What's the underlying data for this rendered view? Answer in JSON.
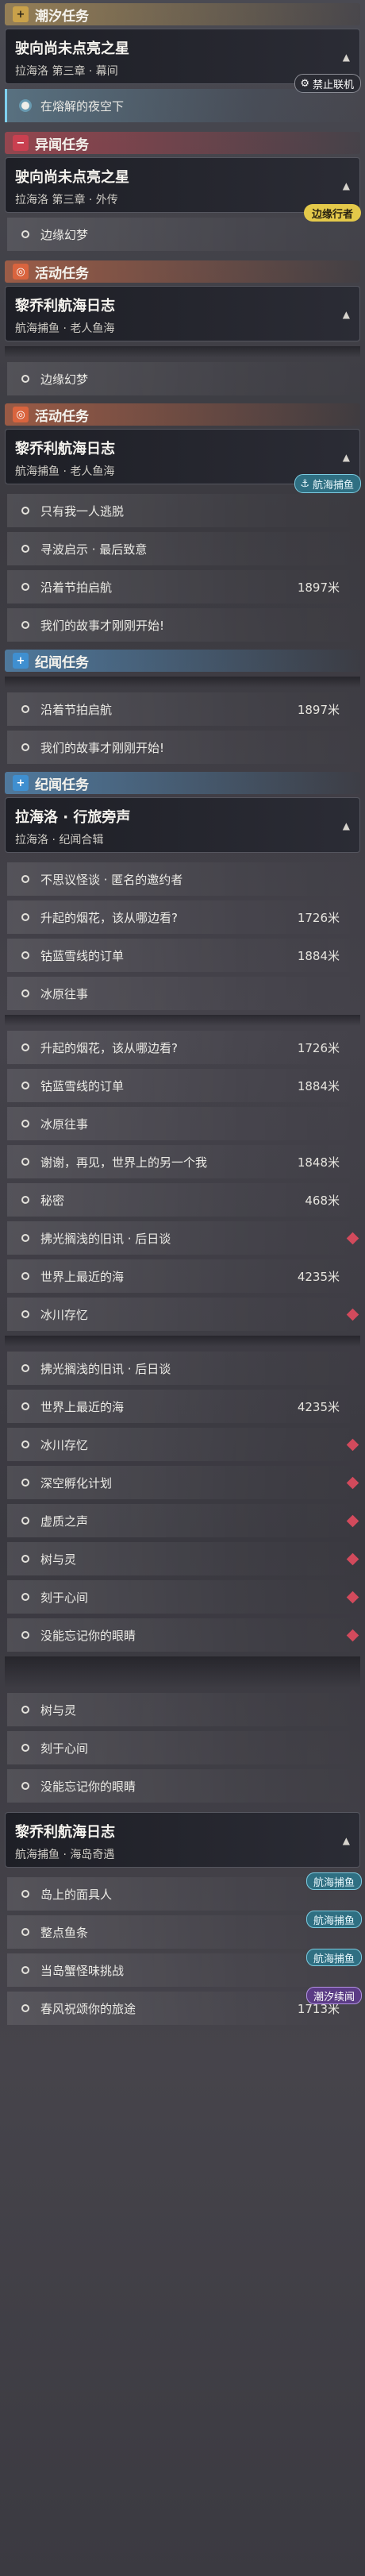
{
  "sections": {
    "chaoxi": "潮汐任务",
    "yiwen": "异闻任务",
    "huodong": "活动任务",
    "jiwen": "纪闻任务"
  },
  "quests": {
    "q1": {
      "title": "驶向尚未点亮之星",
      "sub": "拉海洛 第三章 · 幕间",
      "tag": "禁止联机"
    },
    "q2": {
      "title": "驶向尚未点亮之星",
      "sub": "拉海洛 第三章 · 外传",
      "tag": "边缘行者"
    },
    "q3": {
      "title": "黎乔利航海日志",
      "sub": "航海捕鱼 · 老人鱼海",
      "tag": "航海捕鱼"
    },
    "q4": {
      "title": "拉海洛 · 行旅旁声",
      "sub": "拉海洛 · 纪闻合辑"
    },
    "q5": {
      "title": "黎乔利航海日志",
      "sub": "航海捕鱼 · 海岛奇遇"
    }
  },
  "items": {
    "a1": "在熔解的夜空下",
    "a2": "边缘幻梦",
    "a3": "只有我一人逃脱",
    "a4": "寻波启示 · 最后致意",
    "a5": "沿着节拍启航",
    "a6": "我们的故事才刚刚开始!",
    "a7": "不思议怪谈 · 匿名的邀约者",
    "a8": "升起的烟花，该从哪边看?",
    "a9": "钴蓝雪线的订单",
    "a10": "冰原往事",
    "a11": "谢谢，再见，世界上的另一个我",
    "a12": "秘密",
    "a13": "拂光搁浅的旧讯 · 后日谈",
    "a14": "世界上最近的海",
    "a15": "冰川存忆",
    "a16": "深空孵化计划",
    "a17": "虚质之声",
    "a18": "树与灵",
    "a19": "刻于心间",
    "a20": "没能忘记你的眼睛",
    "a21": "岛上的面具人",
    "a22": "整点鱼条",
    "a23": "当岛蟹怪味挑战",
    "a24": "春风祝颂你的旅途"
  },
  "distances": {
    "d1": "1897米",
    "d2": "1726米",
    "d3": "1884米",
    "d4": "1848米",
    "d5": "468米",
    "d6": "4235米",
    "d7": "1713米"
  },
  "tags": {
    "hanghai": "航海捕鱼",
    "chaoxi_xuwen": "潮汐续闻",
    "jinzhi": "禁止联机",
    "bianyuan": "边缘行者"
  },
  "icons": {
    "chaoxi": "plus-icon",
    "yiwen": "minus-icon",
    "huodong": "swirl-icon",
    "jiwen": "plus-icon",
    "chevron": "chevron-up-icon"
  },
  "colors": {
    "accent_cyan": "#7fd0f0",
    "header_gold": "#c9a14a",
    "header_red": "#c94050",
    "header_orange": "#d9643e",
    "header_blue": "#3f8fd0",
    "diamond_red": "#d24a5c"
  }
}
